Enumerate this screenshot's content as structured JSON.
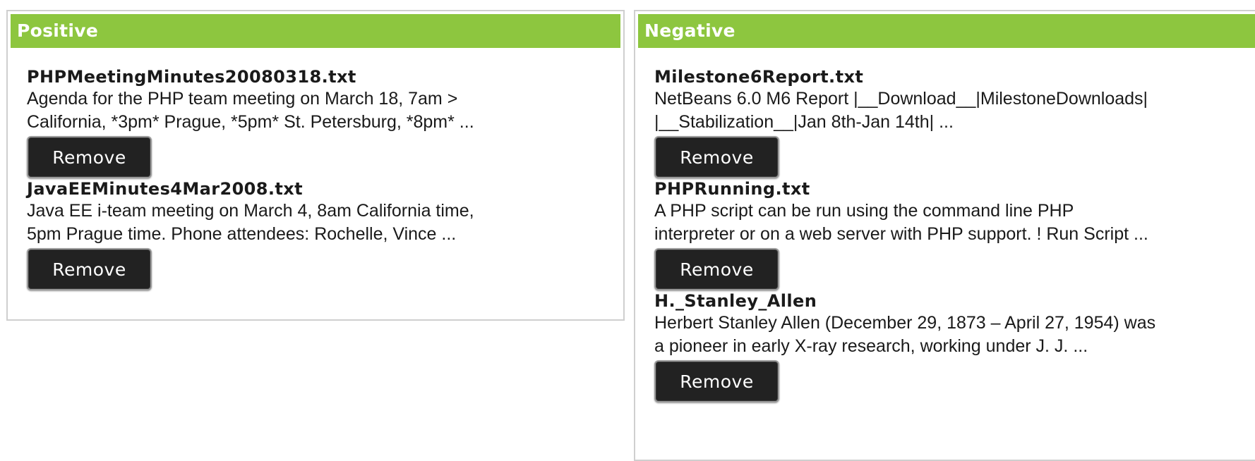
{
  "positive": {
    "header": "Positive",
    "items": [
      {
        "title": "PHPMeetingMinutes20080318.txt",
        "snippet": "Agenda for the PHP team meeting on March 18, 7am >\nCalifornia, *3pm* Prague, *5pm* St. Petersburg, *8pm* ...",
        "button": "Remove"
      },
      {
        "title": "JavaEEMinutes4Mar2008.txt",
        "snippet": "Java EE i-team meeting on March 4, 8am California time,\n5pm Prague time. Phone attendees: Rochelle, Vince ...",
        "button": "Remove"
      }
    ]
  },
  "negative": {
    "header": "Negative",
    "items": [
      {
        "title": "Milestone6Report.txt",
        "snippet": "NetBeans 6.0 M6 Report |__Download__|MilestoneDownloads|\n|__Stabilization__|Jan 8th-Jan 14th| ...",
        "button": "Remove"
      },
      {
        "title": "PHPRunning.txt",
        "snippet": "A PHP script can be run using the command line PHP\ninterpreter or on a web server with PHP support. ! Run Script ...",
        "button": "Remove"
      },
      {
        "title": "H._Stanley_Allen",
        "snippet": "Herbert Stanley Allen (December 29, 1873 – April 27, 1954) was\na pioneer in early X-ray research, working under J. J. ...",
        "button": "Remove"
      }
    ]
  },
  "colors": {
    "header_bg": "#8dc63f",
    "button_bg": "#222222"
  }
}
